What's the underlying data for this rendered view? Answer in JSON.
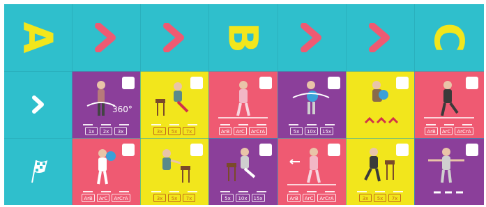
{
  "board": {
    "row1": [
      {
        "kind": "letter",
        "text": "A"
      },
      {
        "kind": "arrow"
      },
      {
        "kind": "arrow"
      },
      {
        "kind": "letter",
        "text": "B"
      },
      {
        "kind": "arrow"
      },
      {
        "kind": "arrow"
      },
      {
        "kind": "letter",
        "text": "C"
      }
    ],
    "row2": {
      "left_icon": "white-chevron-icon",
      "cards": [
        {
          "color": "purple",
          "badge": "scale-icon",
          "counts": [
            "1x",
            "2x",
            "3x"
          ],
          "extra_text": "360°"
        },
        {
          "color": "yellow",
          "badge": "blocks-icon",
          "counts": [
            "3x",
            "5x",
            "7x"
          ]
        },
        {
          "color": "pink",
          "badge": "shoe-icon",
          "counts": [
            "ArB",
            "ArC",
            "ArCrA"
          ]
        },
        {
          "color": "purple",
          "badge": "shoe-icon",
          "counts": [
            "5x",
            "10x",
            "15x"
          ]
        },
        {
          "color": "yellow",
          "badge": "blocks-icon",
          "counts": []
        },
        {
          "color": "pink",
          "badge": "shoe-icon",
          "counts": [
            "ArB",
            "ArC",
            "ArCrA"
          ]
        }
      ]
    },
    "row3": {
      "left_icon": "checkered-flag-icon",
      "cards": [
        {
          "color": "pink",
          "badge": "shoe-icon",
          "counts": [
            "ArB",
            "ArC",
            "ArCrA"
          ]
        },
        {
          "color": "yellow",
          "badge": "shoe-icon",
          "counts": [
            "3x",
            "5x",
            "7x"
          ]
        },
        {
          "color": "purple",
          "badge": "shoe-icon",
          "counts": [
            "5x",
            "10x",
            "15x"
          ]
        },
        {
          "color": "pink",
          "badge": "shoe-icon",
          "counts": [
            "ArB",
            "ArC",
            "ArCrA"
          ]
        },
        {
          "color": "yellow",
          "badge": "blocks-icon",
          "counts": [
            "3x",
            "5x",
            "7x"
          ]
        },
        {
          "color": "purple",
          "badge": "scale-icon",
          "counts": []
        }
      ]
    },
    "colors": {
      "teal": "#2fbfcc",
      "purple": "#8b3f9a",
      "yellow": "#f2e61c",
      "pink": "#ef5a72",
      "arrow": "#ef5a72",
      "letter": "#f2e61c"
    }
  }
}
